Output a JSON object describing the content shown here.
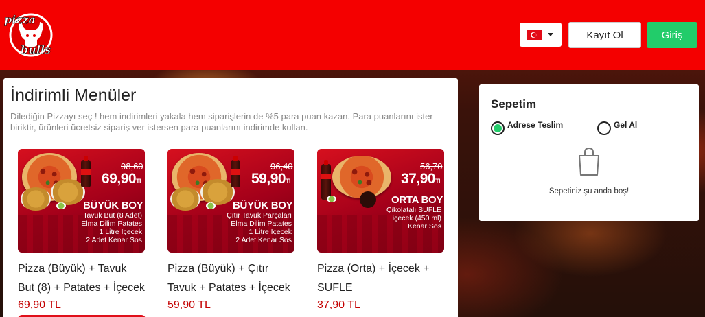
{
  "header": {
    "brand_top": "pizza",
    "brand_bottom": "bulls",
    "register_label": "Kayıt Ol",
    "login_label": "Giriş",
    "language_flag": "turkey-flag-icon",
    "colors": {
      "header_bg": "#f40000",
      "accent_green": "#22cc6a",
      "price_red": "#c40000"
    }
  },
  "menu": {
    "title": "İndirimli Menüler",
    "description": "Dilediğin Pizzayı seç ! hem indirimleri yakala hem siparişlerin de %5 para puan kazan. Para puanlarını ister biriktir, ürünleri ücretsiz sipariş ver istersen para puanlarını indirimde kullan.",
    "items": [
      {
        "old_price": "98,60",
        "new_price": "69,90",
        "price_suffix": "TL",
        "size": "BÜYÜK BOY",
        "contents": [
          "Tavuk But (8 Adet)",
          "Elma Dilim Patates",
          "1 Litre İçecek",
          "2 Adet Kenar Sos"
        ],
        "name_line1": "Pizza (Büyük) + Tavuk",
        "name_line2": "But (8) + Patates + İçecek",
        "price": "69,90 TL"
      },
      {
        "old_price": "96,40",
        "new_price": "59,90",
        "price_suffix": "TL",
        "size": "BÜYÜK BOY",
        "contents": [
          "Çıtır Tavuk Parçaları",
          "Elma Dilim Patates",
          "1 Litre İçecek",
          "2 Adet Kenar Sos"
        ],
        "name_line1": "Pizza (Büyük) + Çıtır",
        "name_line2": "Tavuk + Patates + İçecek",
        "price": "59,90 TL"
      },
      {
        "old_price": "56,70",
        "new_price": "37,90",
        "price_suffix": "TL",
        "size": "ORTA BOY",
        "contents": [
          "Çikolatalı SUFLE",
          "içecek (450 ml)",
          "Kenar Sos"
        ],
        "name_line1": "Pizza (Orta) + İçecek +",
        "name_line2": "SUFLE",
        "price": "37,90 TL"
      }
    ]
  },
  "cart": {
    "title": "Sepetim",
    "options": [
      {
        "label": "Adrese Teslim",
        "selected": true
      },
      {
        "label": "Gel Al",
        "selected": false
      }
    ],
    "empty_text": "Sepetiniz şu anda boş!",
    "icon": "shopping-bag-icon"
  }
}
